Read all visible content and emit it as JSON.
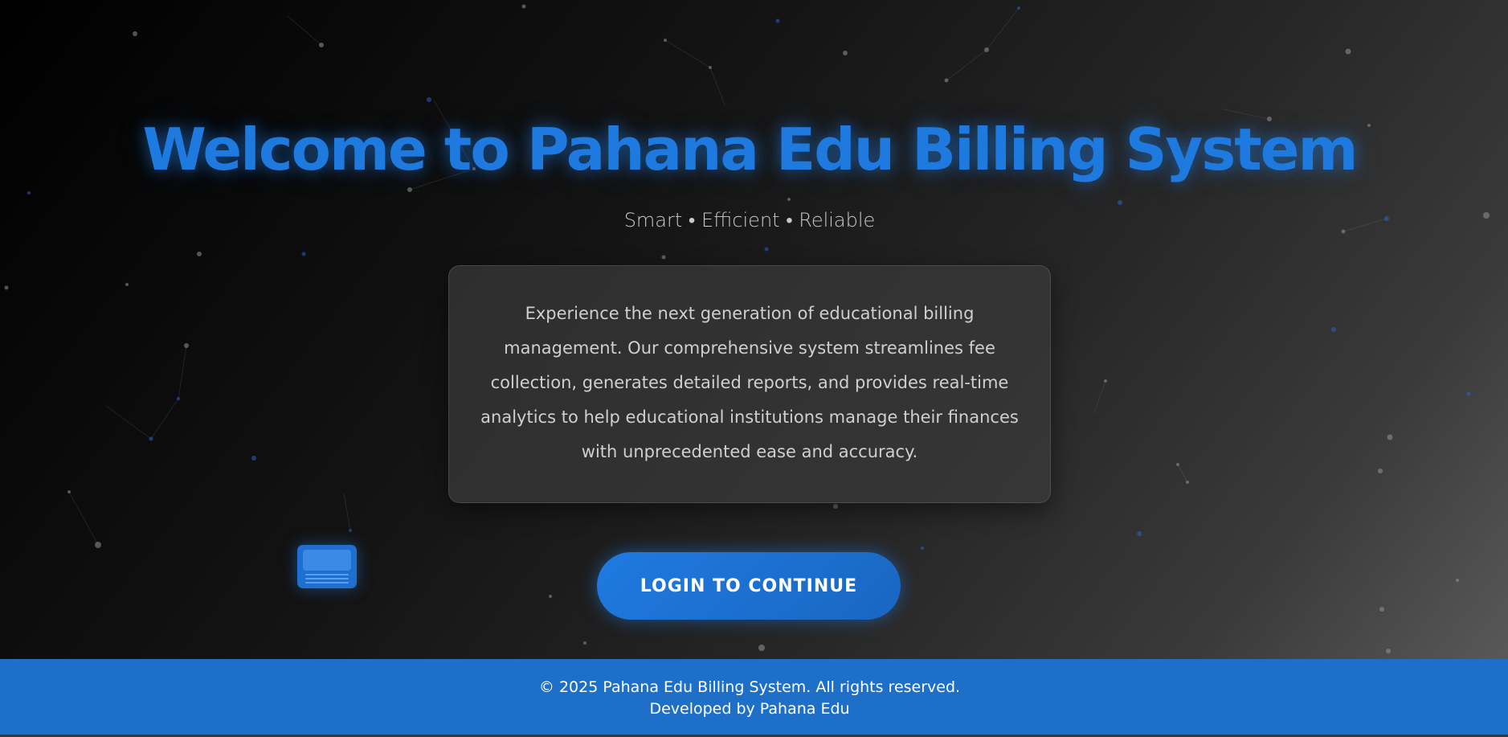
{
  "hero": {
    "title": "Welcome to Pahana Edu Billing System",
    "subtitle": "Smart • Efficient • Reliable",
    "description": "Experience the next generation of educational billing management. Our comprehensive system streamlines fee collection, generates detailed reports, and provides real-time analytics to help educational institutions manage their finances with unprecedented ease and accuracy.",
    "login_button_label": "LOGIN TO CONTINUE"
  },
  "decor": {
    "floating_icon": "billing-card-icon"
  },
  "footer": {
    "copyright": "© 2025 Pahana Edu Billing System. All rights reserved.",
    "credit": "Developed by Pahana Edu"
  },
  "colors": {
    "accent": "#1f7ae0",
    "footer_bg": "#1e6fc8",
    "text_muted": "#c9c9c9"
  }
}
